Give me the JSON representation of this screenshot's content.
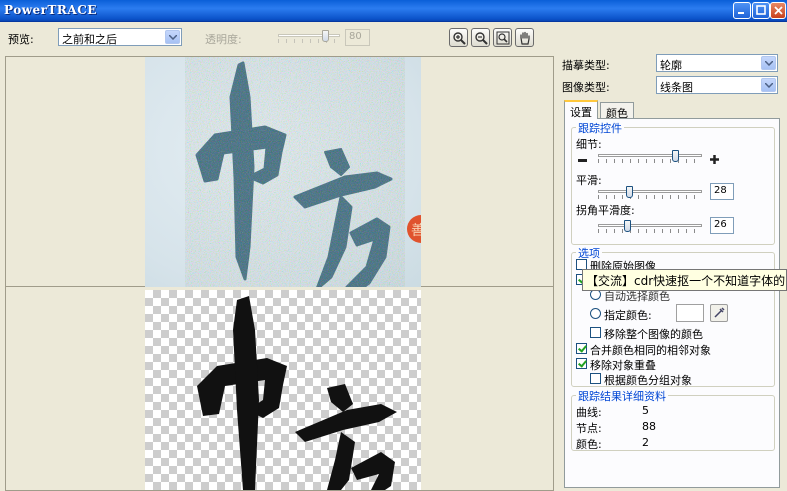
{
  "window": {
    "title": "PowerTRACE"
  },
  "toolbar": {
    "preview_label": "预览:",
    "preview_value": "之前和之后",
    "transparency_label": "透明度:",
    "transparency_value": "80"
  },
  "side": {
    "trace_type_label": "描摹类型:",
    "trace_type_value": "轮廓",
    "image_type_label": "图像类型:",
    "image_type_value": "线条图",
    "tabs": [
      "设置",
      "颜色"
    ],
    "trace_controls": {
      "title": "跟踪控件",
      "detail_label": "细节:",
      "smoothing_label": "平滑:",
      "smoothing_value": "28",
      "corner_label": "拐角平滑度:",
      "corner_value": "26"
    },
    "options": {
      "title": "选项",
      "delete_original": "删除原始图像",
      "specify_color": "指定颜色:",
      "remove_whole_color": "移除整个图像的颜色",
      "merge_adjacent": "合并颜色相同的相邻对象",
      "remove_overlap": "移除对象重叠",
      "group_by_color": "根据颜色分组对象",
      "partial_hidden": "自动选择颜色"
    },
    "results": {
      "title": "跟踪结果详细资料",
      "curves_label": "曲线:",
      "curves_value": "5",
      "nodes_label": "节点:",
      "nodes_value": "88",
      "colors_label": "颜色:",
      "colors_value": "2"
    }
  },
  "tooltip": "【交流】cdr快速抠一个不知道字体的",
  "preview": {
    "stamp_text": "善"
  },
  "colors": {
    "title_bar": "#0a5fd8",
    "tab_highlight": "#ffc83c",
    "group_title": "#0046d5",
    "ink": "#111111"
  }
}
